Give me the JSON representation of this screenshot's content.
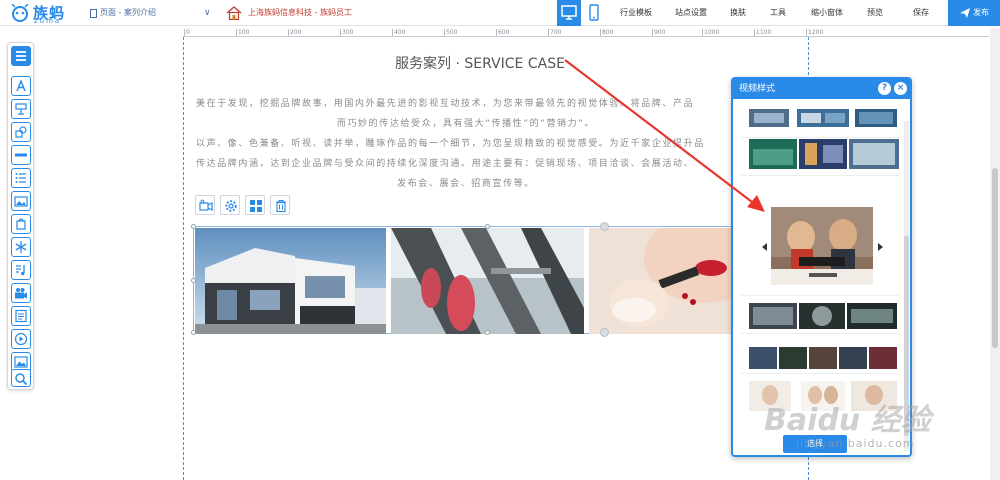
{
  "brand": {
    "logo_text": "族蚂",
    "logo_sub": "zuma"
  },
  "topbar": {
    "page_select": "页面 - 案列介绍",
    "site_name": "上海族蚂信息科技 - 族蚂员工",
    "menu": [
      "行业模板",
      "站点设置",
      "换肤",
      "工具",
      "缩小窗体",
      "预览",
      "保存"
    ],
    "publish": "发布"
  },
  "ruler": {
    "ticks": [
      "0",
      "100",
      "200",
      "300",
      "400",
      "500",
      "600",
      "700",
      "800",
      "900",
      "1000",
      "1100",
      "1200"
    ]
  },
  "content": {
    "title": "服务案列 · SERVICE CASE",
    "paragraphs": [
      "美在于发现，挖掘品牌故事，用国内外最先进的影视互动技术，为您来带最领先的视觉体验。将品牌、产品",
      "而巧妙的传达给受众，具有强大“传播性”的“营销力”。",
      "以声、像、色兼备、听视、读并举，雕琢作品的每一个细节，为您呈现精致的视觉感受。为近千家企业提升品",
      "传达品牌内涵，达到企业品牌与受众间的持续化深度沟通。用途主要有：促销现场、项目洽谈、会展活动、",
      "发布会、展会、招商宣传等。"
    ]
  },
  "panel": {
    "title": "视频样式",
    "help": "?",
    "close": "×",
    "confirm": "选择"
  },
  "colors": {
    "accent": "#2a8ae8",
    "arrow": "#e8362f"
  },
  "watermark": {
    "main": "Baidu 经验",
    "sub": "jingyan.baidu.com"
  }
}
